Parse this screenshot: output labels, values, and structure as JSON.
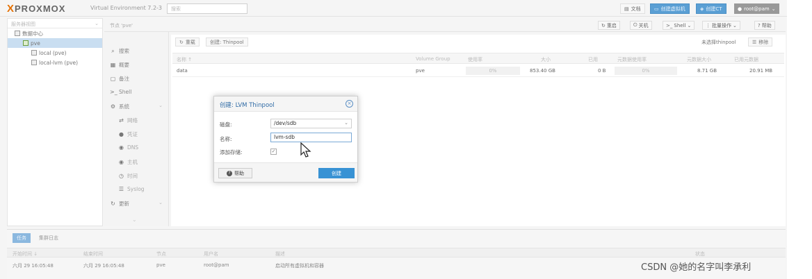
{
  "topbar": {
    "logo_x": "X",
    "logo_text": "PROXMOX",
    "version": "Virtual Environment 7.2-3",
    "search_placeholder": "搜索",
    "docs": "文档",
    "create_vm": "创建虚拟机",
    "create_ct": "创建CT",
    "user": "root@pam"
  },
  "tree": {
    "view_select": "服务器视图",
    "items": [
      {
        "label": "数据中心"
      },
      {
        "label": "pve"
      },
      {
        "label": "local (pve)"
      },
      {
        "label": "local-lvm (pve)"
      }
    ]
  },
  "header": {
    "crumb": "节点 'pve'",
    "reboot": "重启",
    "shutdown": "关机",
    "shell": "Shell",
    "bulk": "批量操作",
    "help": "帮助"
  },
  "nav": {
    "items": [
      {
        "label": "搜索",
        "icon": "search-icon"
      },
      {
        "label": "概要",
        "icon": "summary-icon"
      },
      {
        "label": "备注",
        "icon": "notes-icon"
      },
      {
        "label": "Shell",
        "icon": "terminal-icon"
      },
      {
        "label": "系统",
        "icon": "gears-icon"
      },
      {
        "label": "网络",
        "icon": "network-icon"
      },
      {
        "label": "凭证",
        "icon": "certificate-icon"
      },
      {
        "label": "DNS",
        "icon": "globe-icon"
      },
      {
        "label": "主机",
        "icon": "globe-icon"
      },
      {
        "label": "时间",
        "icon": "clock-icon"
      },
      {
        "label": "Syslog",
        "icon": "list-icon"
      },
      {
        "label": "更新",
        "icon": "refresh-icon"
      }
    ]
  },
  "grid": {
    "reload": "重载",
    "create_thinpool": "创建: Thinpool",
    "no_selected": "未选择thinpool",
    "remove": "移除",
    "columns": [
      "名称 ↑",
      "Volume Group",
      "使用率",
      "大小",
      "已用",
      "元数据使用率",
      "元数据大小",
      "已用元数据"
    ],
    "rows": [
      {
        "name": "data",
        "vg": "pve",
        "usage": "0%",
        "size": "853.40 GB",
        "used": "0 B",
        "meta_usage": "0%",
        "meta_size": "8.71 GB",
        "meta_used": "20.91 MB"
      }
    ]
  },
  "tasks": {
    "tab_tasks": "任务",
    "tab_cluster_log": "集群日志",
    "columns": [
      "开始时间 ↓",
      "结束时间",
      "节点",
      "用户名",
      "描述",
      "状态"
    ],
    "rows": [
      {
        "start": "六月 29 16:05:48",
        "end": "六月 29 16:05:48",
        "node": "pve",
        "user": "root@pam",
        "desc": "启动所有虚拟机和容器",
        "status": ""
      }
    ]
  },
  "dialog": {
    "title": "创建: LVM Thinpool",
    "disk_label": "磁盘:",
    "disk_value": "/dev/sdb",
    "name_label": "名称:",
    "name_value": "lvm-sdb",
    "add_storage_label": "添加存储:",
    "add_storage_checked": "☑",
    "help": "帮助",
    "create": "创建"
  },
  "watermark": "CSDN @她的名字叫李承利"
}
